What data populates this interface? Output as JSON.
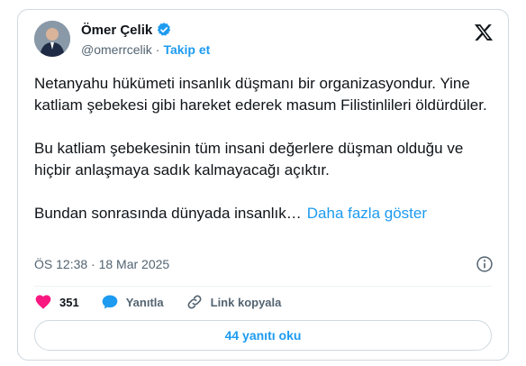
{
  "author": {
    "name": "Ömer Çelik",
    "handle": "@omerrcelik",
    "separator": "·",
    "follow_label": "Takip et"
  },
  "tweet": {
    "paragraphs": [
      "Netanyahu hükümeti insanlık düşmanı bir organizasyondur. Yine katliam şebekesi gibi hareket ederek masum Filistinlileri öldürdüler.",
      "Bu katliam şebekesinin tüm insani değerlere düşman olduğu ve hiçbir anlaşmaya sadık kalmayacağı açıktır."
    ],
    "truncated_text": "Bundan sonrasında dünyada insanlık…",
    "show_more_label": "Daha fazla göster",
    "timestamp": "ÖS 12:38 · 18 Mar 2025"
  },
  "actions": {
    "like_count": "351",
    "reply_label": "Yanıtla",
    "copy_link_label": "Link kopyala"
  },
  "replies_button_label": "44 yanıtı oku",
  "colors": {
    "accent": "#1d9bf0",
    "like": "#f91880",
    "verified": "#1d9bf0",
    "text": "#0f1419",
    "secondary": "#536471"
  },
  "icons": {
    "verified": "verified-badge-icon",
    "x_logo": "x-logo-icon",
    "info": "info-icon",
    "like": "heart-icon",
    "reply": "reply-bubble-icon",
    "copy_link": "link-icon"
  }
}
